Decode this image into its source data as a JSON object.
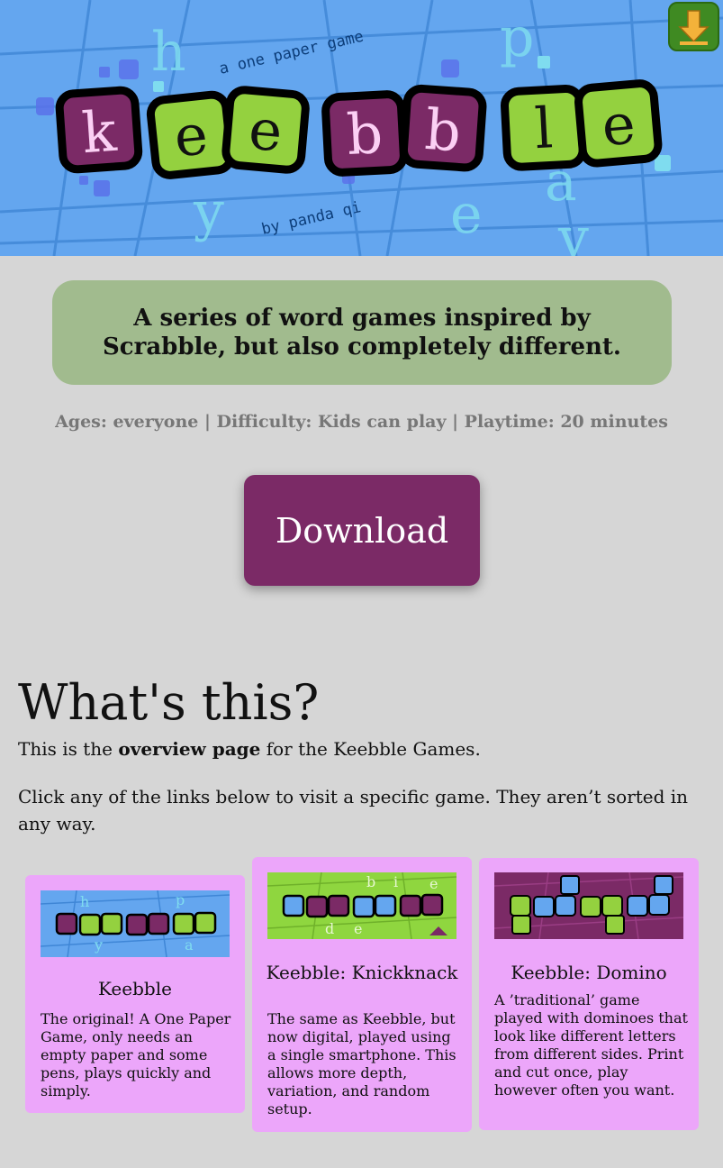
{
  "header": {
    "logo_letters": [
      "k",
      "e",
      "e",
      "b",
      "b",
      "l",
      "e"
    ],
    "subtitle_top": "a one paper game",
    "subtitle_bottom": "by panda qi",
    "bg_letters": [
      "h",
      "y",
      "p",
      "e",
      "a",
      "y"
    ],
    "home_icon": "download-arrow-icon"
  },
  "tagline": "A series of word games inspired by Scrabble, but also completely different.",
  "meta": "Ages: everyone | Difficulty: Kids can play | Playtime: 20 minutes",
  "download_label": "Download",
  "section": {
    "title": "What's this?",
    "p1_prefix": "This is the ",
    "p1_bold": "overview page",
    "p1_suffix": " for the Keebble Games.",
    "p2": "Click any of the links below to visit a specific game. They aren’t sorted in any way."
  },
  "cards": [
    {
      "title": "Keebble",
      "desc": "The original! A One Paper Game, only needs an empty paper and some pens, plays quickly and simply.",
      "thumb_bg": "#64a6ef"
    },
    {
      "title": "Keebble: Knickknack",
      "desc": "The same as Keebble, but now digital, played using a single smartphone. This allows more depth, variation, and random setup.",
      "thumb_bg": "#8fd63f"
    },
    {
      "title": "Keebble: Domino",
      "desc": "A ’traditional’ game played with dominoes that look like different letters from different sides. Print and cut once, play however often you want.",
      "thumb_bg": "#7b2a66"
    }
  ],
  "colors": {
    "accent": "#7b2a66",
    "green_tile": "#94d13f",
    "purple_tile": "#7b2a66",
    "banner_bg": "#64a6ef",
    "card_bg": "#eca6fa",
    "tagline_bg": "#a1bb8e"
  }
}
